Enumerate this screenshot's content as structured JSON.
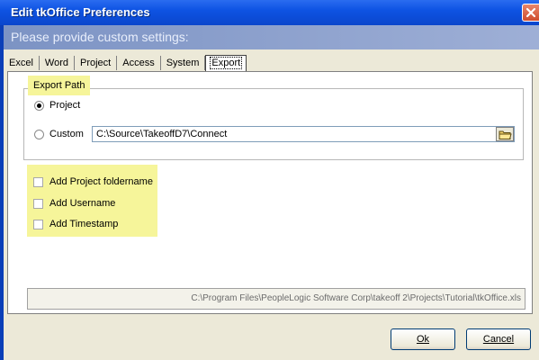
{
  "window": {
    "title": "Edit tkOffice Preferences",
    "subtitle": "Please provide custom settings:"
  },
  "tabs": [
    {
      "label": "Excel"
    },
    {
      "label": "Word"
    },
    {
      "label": "Project"
    },
    {
      "label": "Access"
    },
    {
      "label": "System"
    },
    {
      "label": "Export",
      "active": true
    }
  ],
  "export_path": {
    "group_label": "Export Path",
    "option_project": "Project",
    "option_custom": "Custom",
    "selected": "Project",
    "custom_path_value": "C:\\Source\\TakeoffD7\\Connect"
  },
  "options": {
    "add_project_foldername": "Add Project foldername",
    "add_username": "Add Username",
    "add_timestamp": "Add Timestamp"
  },
  "status_path": "C:\\Program Files\\PeopleLogic Software Corp\\takeoff 2\\Projects\\Tutorial\\tkOffice.xls",
  "buttons": {
    "ok_label": "Ok",
    "cancel_label": "Cancel"
  },
  "colors": {
    "highlight": "#f6f59a",
    "titlebar": "#0e53e3"
  }
}
